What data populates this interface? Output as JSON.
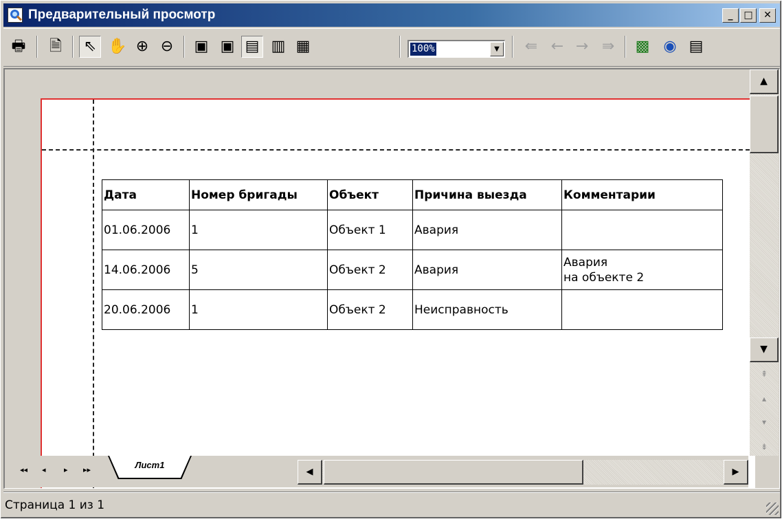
{
  "window": {
    "title": "Предварительный просмотр",
    "buttons": {
      "minimize": "_",
      "maximize": "□",
      "close": "✕"
    }
  },
  "toolbar": {
    "zoom_value": "100%",
    "icons": {
      "print": "🖶",
      "page_setup": "🗎",
      "select": "⇖",
      "hand": "✋",
      "zoom_in": "⊕",
      "zoom_out": "⊖",
      "page_width": "▣",
      "whole_page": "▣",
      "one_page": "▤",
      "two_pages": "▥",
      "multi_pages": "▦",
      "first": "⇚",
      "prev": "←",
      "next": "→",
      "last": "⇛",
      "export_excel": "▩",
      "export_html": "◉",
      "export_text": "▤",
      "dropdown_arrow": "▼"
    }
  },
  "report": {
    "headers": [
      "Дата",
      "Номер бригады",
      "Объект",
      "Причина выезда",
      "Комментарии"
    ],
    "rows": [
      {
        "date": "01.06.2006",
        "team": "1",
        "object": "Объект 1",
        "reason": "Авария",
        "comment_line1": "",
        "comment_line2": ""
      },
      {
        "date": "14.06.2006",
        "team": "5",
        "object": "Объект 2",
        "reason": "Авария",
        "comment_line1": "Авария",
        "comment_line2": "на объекте 2"
      },
      {
        "date": "20.06.2006",
        "team": "1",
        "object": "Объект 2",
        "reason": "Неисправность",
        "comment_line1": "",
        "comment_line2": ""
      }
    ]
  },
  "sheet": {
    "tab_label": "Лист1",
    "nav": {
      "first": "◂◂",
      "prev": "◂",
      "next": "▸",
      "last": "▸▸"
    }
  },
  "scrollbar": {
    "up": "▲",
    "down": "▼",
    "left": "◀",
    "right": "▶",
    "page_first": "⇞",
    "page_prev": "▴",
    "page_next": "▾",
    "page_last": "⇟"
  },
  "status": {
    "text": "Страница 1 из 1"
  },
  "colors": {
    "title_gradient_start": "#0a246a",
    "page_border": "#e03030",
    "chrome": "#d4d0c8"
  }
}
